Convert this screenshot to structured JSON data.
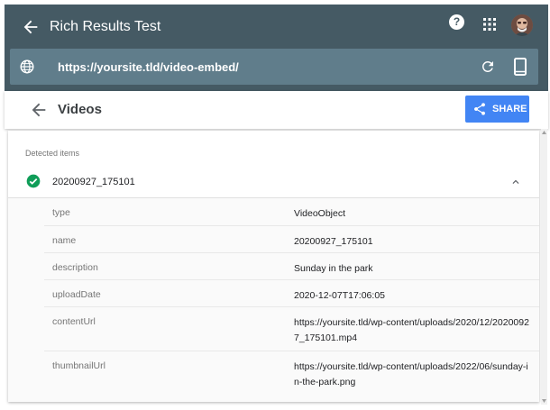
{
  "app": {
    "title": "Rich Results Test",
    "help_icon": "help-icon",
    "apps_icon": "apps-grid-icon",
    "avatar_icon": "user-avatar"
  },
  "urlbar": {
    "url": "https://yoursite.tld/video-embed/",
    "globe_icon": "globe-icon",
    "refresh_icon": "refresh-icon",
    "device_icon": "smartphone-icon"
  },
  "subheader": {
    "title": "Videos",
    "share_label": "SHARE",
    "share_icon": "share-icon"
  },
  "detected": {
    "label": "Detected items",
    "item_name": "20200927_175101",
    "status_icon": "check-circle-icon",
    "expanded": true
  },
  "properties": [
    {
      "name": "type",
      "value": "VideoObject"
    },
    {
      "name": "name",
      "value": "20200927_175101"
    },
    {
      "name": "description",
      "value": "Sunday in the park"
    },
    {
      "name": "uploadDate",
      "value": "2020-12-07T17:06:05"
    },
    {
      "name": "contentUrl",
      "value": "https://yoursite.tld/wp-content/uploads/2020/12/20200927_175101.mp4"
    },
    {
      "name": "thumbnailUrl",
      "value": "https://yoursite.tld/wp-content/uploads/2022/06/sunday-in-the-park.png"
    }
  ],
  "colors": {
    "topbar": "#455a64",
    "urlbar": "#607d8b",
    "accent": "#4285f4",
    "valid": "#0f9d58"
  }
}
